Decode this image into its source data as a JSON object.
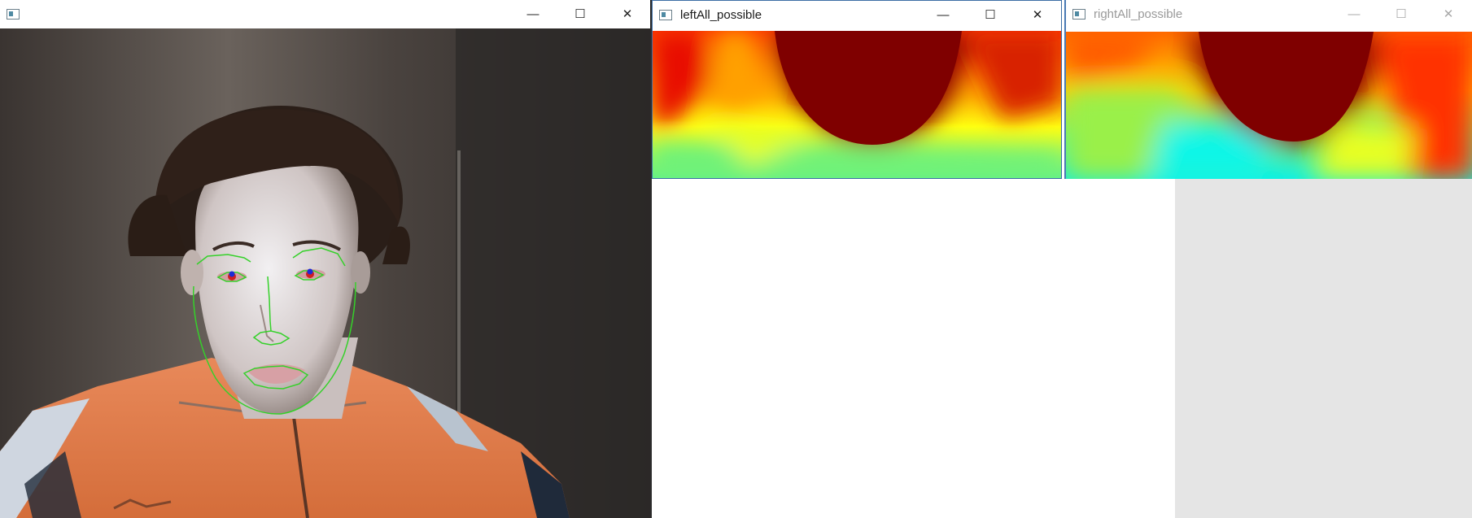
{
  "windows": {
    "camera": {
      "title": "",
      "controls": {
        "minimize": "—",
        "maximize": "☐",
        "close": "✕"
      }
    },
    "left": {
      "title": "leftAll_possible",
      "controls": {
        "minimize": "—",
        "maximize": "☐",
        "close": "✕"
      }
    },
    "right": {
      "title": "rightAll_possible",
      "controls": {
        "minimize": "—",
        "maximize": "☐",
        "close": "✕"
      }
    }
  },
  "colors": {
    "heatmap_hot": "#7f0000",
    "heatmap_mid": "#ffff00",
    "heatmap_cool": "#00ffff",
    "face_landmarks": "#35d12a",
    "pupil_marker": "#1d2bd6",
    "iris_marker": "#d02020"
  }
}
